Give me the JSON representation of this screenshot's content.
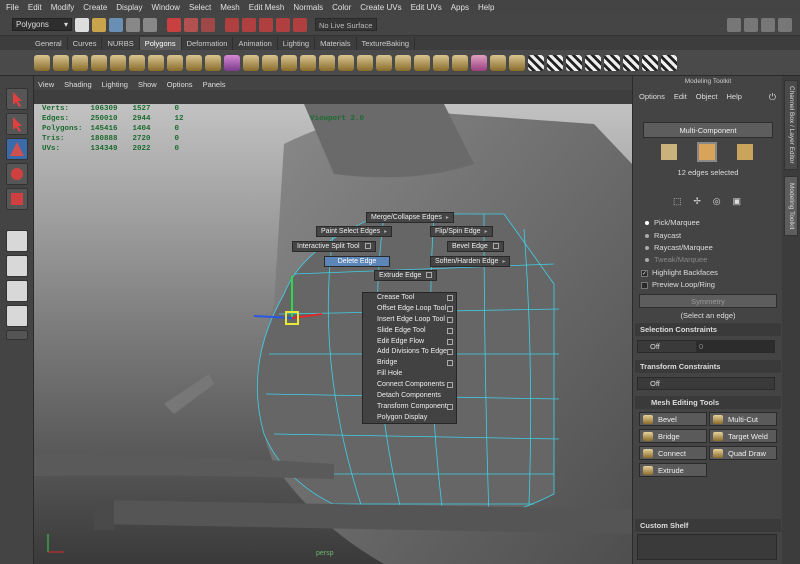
{
  "menubar": [
    "File",
    "Edit",
    "Modify",
    "Create",
    "Display",
    "Window",
    "Select",
    "Mesh",
    "Edit Mesh",
    "Normals",
    "Color",
    "Create UVs",
    "Edit UVs",
    "Apps",
    "Help"
  ],
  "statusline": {
    "mode": "Polygons",
    "live_surface": "No Live Surface"
  },
  "shelf_tabs": [
    "General",
    "Curves",
    "NURBS",
    "Polygons",
    "Deformation",
    "Animation",
    "Lighting",
    "Materials",
    "TextureBaking"
  ],
  "shelf_active": "Polygons",
  "panel_menu": [
    "View",
    "Shading",
    "Lighting",
    "Show",
    "Options",
    "Panels"
  ],
  "hud": [
    {
      "label": "Verts:",
      "a": "106309",
      "b": "1527",
      "c": "0"
    },
    {
      "label": "Edges:",
      "a": "250010",
      "b": "2944",
      "c": "12"
    },
    {
      "label": "Polygons:",
      "a": "145416",
      "b": "1404",
      "c": "0"
    },
    {
      "label": "Tris:",
      "a": "180888",
      "b": "2720",
      "c": "0"
    },
    {
      "label": "UVs:",
      "a": "134349",
      "b": "2022",
      "c": "0"
    }
  ],
  "viewport_label": "Viewport 2.0",
  "camera_label": "persp",
  "marking_menu": {
    "merge": "Merge/Collapse Edges",
    "paint": "Paint Select Edges",
    "flip": "Flip/Spin Edge",
    "split": "Interactive Split Tool",
    "bevel": "Bevel Edge",
    "delete": "Delete Edge",
    "soften": "Soften/Harden Edge",
    "extrude": "Extrude Edge"
  },
  "context_menu": [
    "Crease Tool",
    "Offset Edge Loop Tool",
    "Insert Edge Loop Tool",
    "Slide Edge Tool",
    "Edit Edge Flow",
    "Add Divisions To Edge",
    "Bridge",
    "Fill Hole",
    "Connect Components",
    "Detach Components",
    "Transform Component",
    "Polygon Display"
  ],
  "context_checkboxes": [
    true,
    true,
    true,
    true,
    true,
    true,
    true,
    false,
    true,
    false,
    true,
    false
  ],
  "modeling_toolkit": {
    "title": "Modeling Toolkit",
    "menu": [
      "Options",
      "Edit",
      "Object",
      "Help"
    ],
    "multi_component": "Multi-Component",
    "selected_count": "12 edges selected",
    "pick_modes": [
      "Pick/Marquee",
      "Raycast",
      "Raycast/Marquee",
      "Tweak/Marquee"
    ],
    "highlight_backfaces": "Highlight Backfaces",
    "preview_loop": "Preview Loop/Ring",
    "symmetry": "Symmetry",
    "select_hint": "(Select an edge)",
    "selection_constraints": "Selection Constraints",
    "selection_off": "Off",
    "selection_value": "0",
    "transform_constraints": "Transform Constraints",
    "transform_off": "Off",
    "mesh_editing_tools": "Mesh Editing Tools",
    "tools": [
      "Bevel",
      "Multi-Cut",
      "Bridge",
      "Target Weld",
      "Connect",
      "Quad Draw",
      "Extrude"
    ],
    "custom_shelf": "Custom Shelf"
  },
  "side_tabs": [
    "Channel Box / Layer Editor",
    "Modeling Toolkit"
  ]
}
